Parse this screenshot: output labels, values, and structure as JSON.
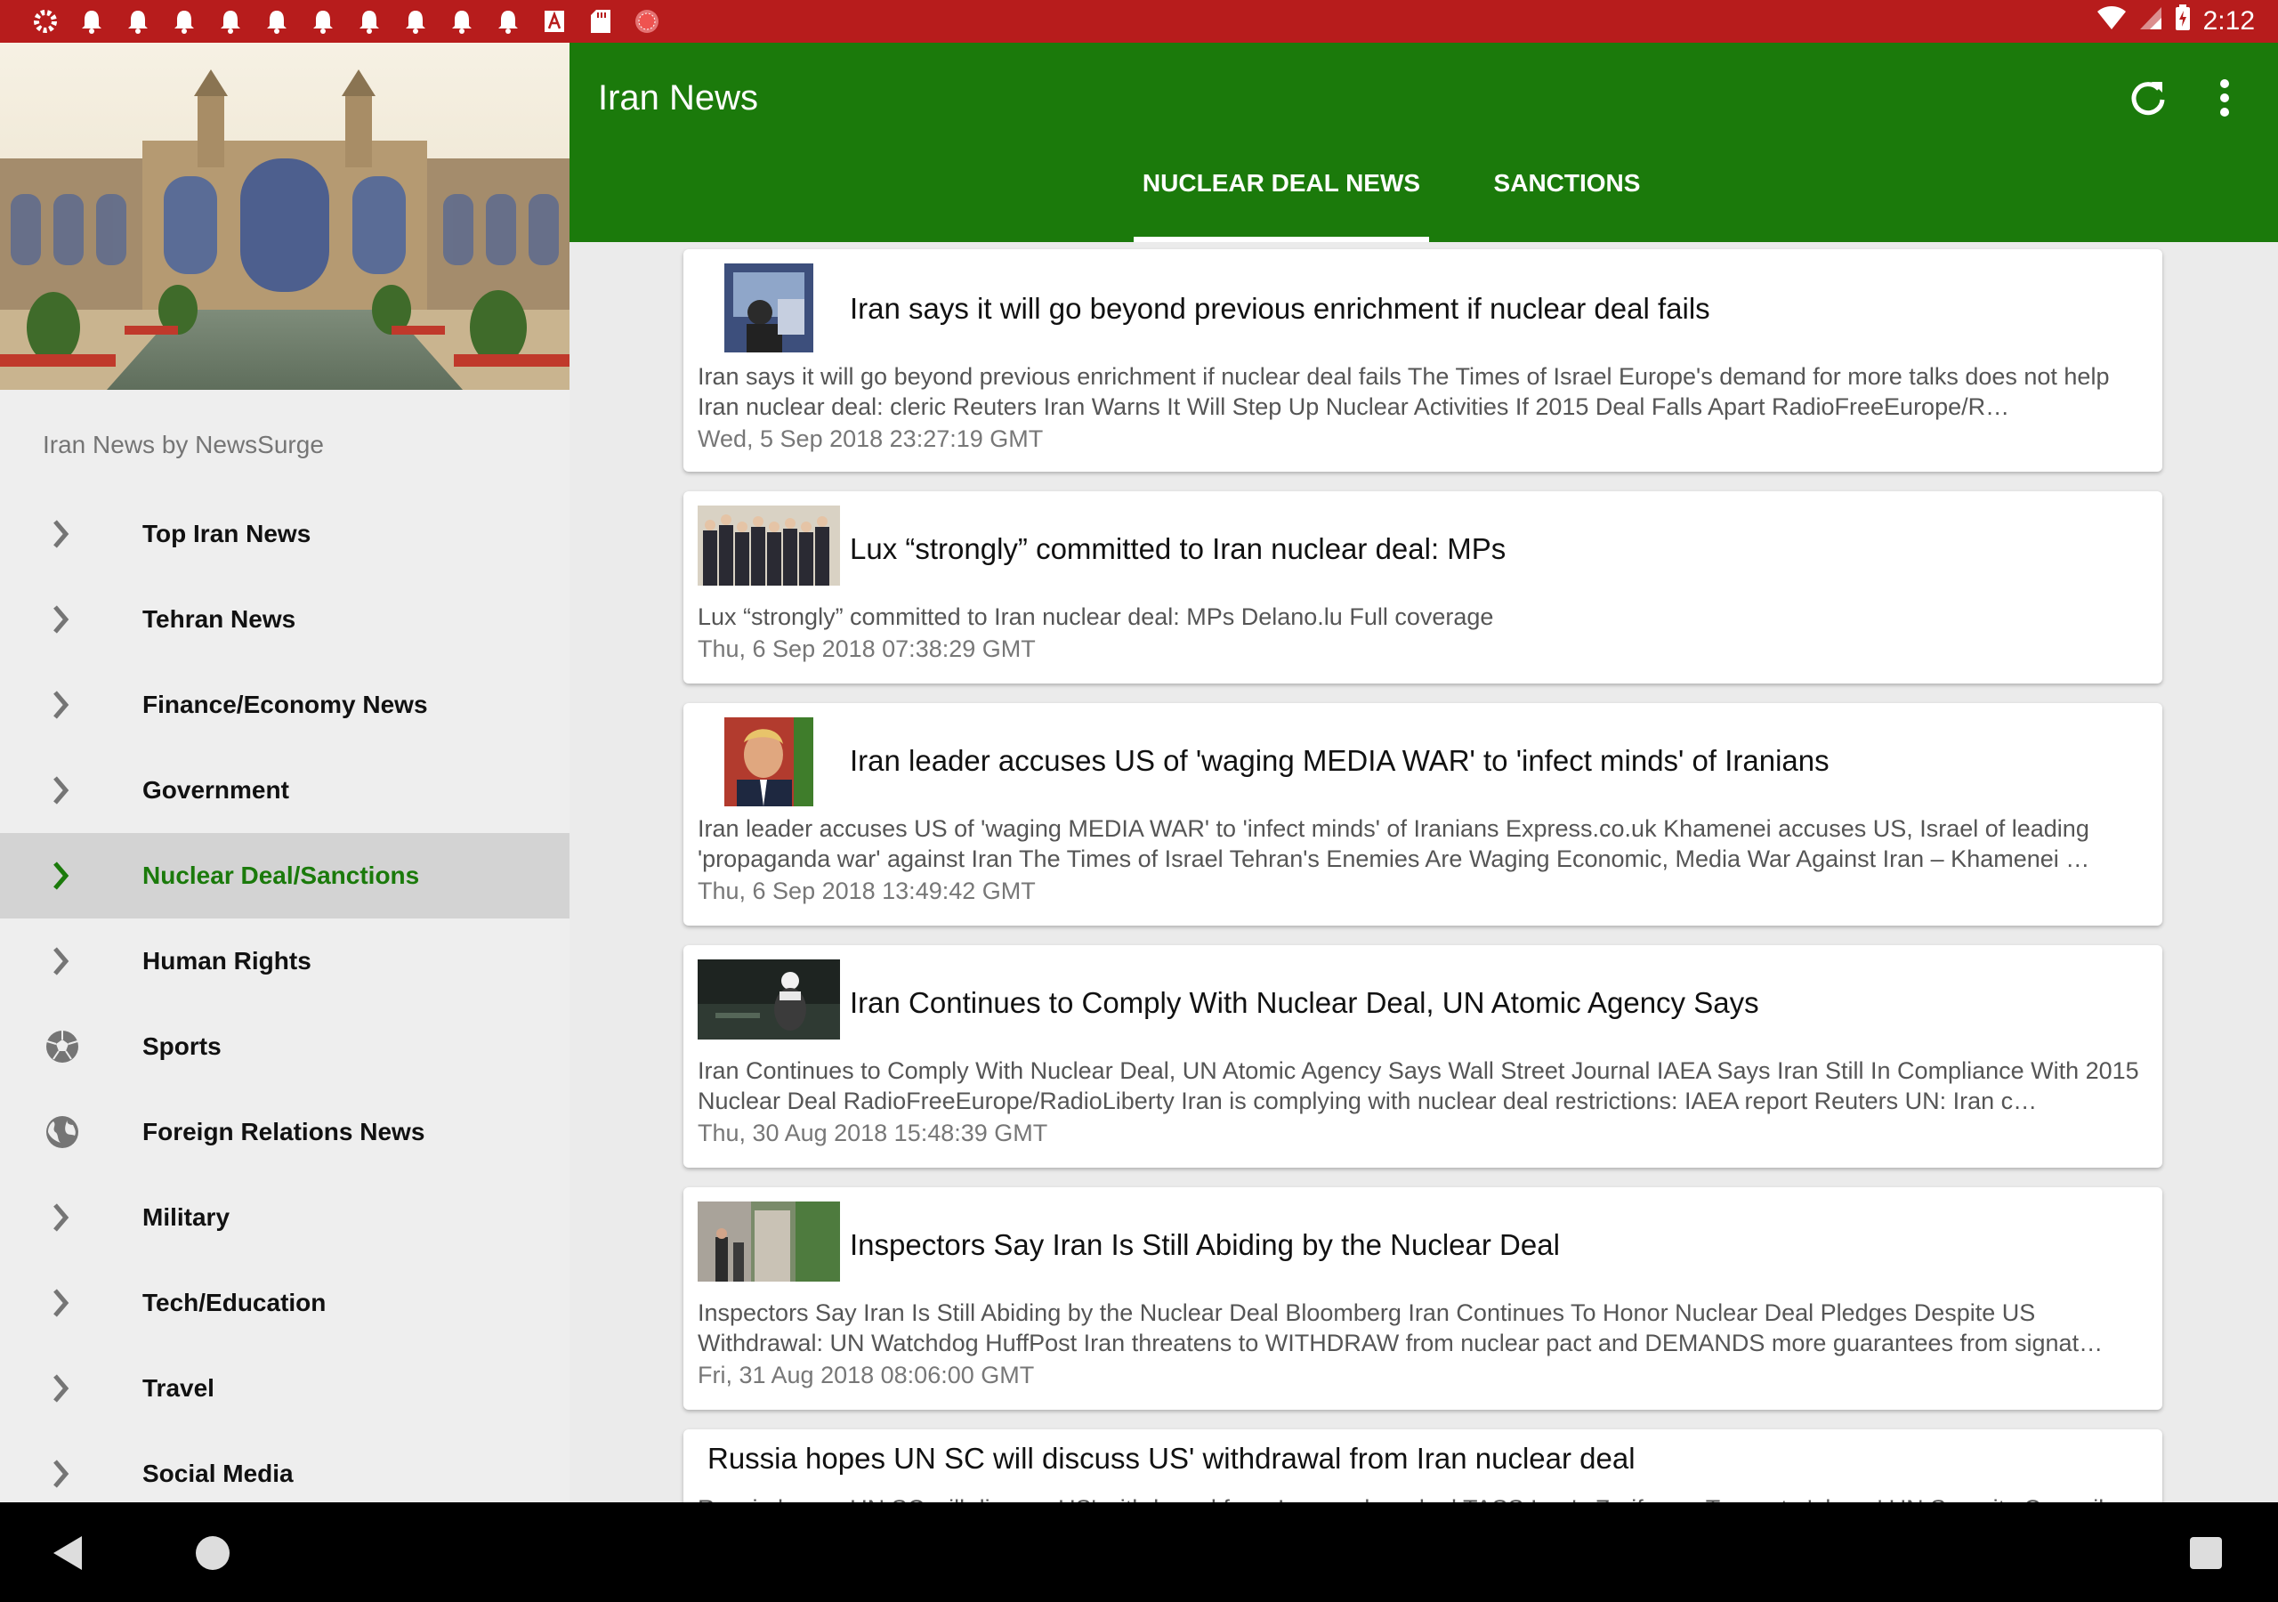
{
  "status_bar": {
    "time": "2:12",
    "notification_icons": [
      "gear-icon",
      "bell-icon",
      "bell-icon",
      "bell-icon",
      "bell-icon",
      "bell-icon",
      "bell-icon",
      "bell-icon",
      "bell-icon",
      "bell-icon",
      "bell-icon",
      "font-icon",
      "sd-card-icon",
      "record-icon"
    ]
  },
  "drawer": {
    "subtitle": "Iran News by NewsSurge",
    "items": [
      {
        "label": "Top Iran News",
        "icon": "chevron-right-icon"
      },
      {
        "label": "Tehran News",
        "icon": "chevron-right-icon"
      },
      {
        "label": "Finance/Economy News",
        "icon": "chevron-right-icon"
      },
      {
        "label": "Government",
        "icon": "chevron-right-icon"
      },
      {
        "label": "Nuclear Deal/Sanctions",
        "icon": "chevron-right-icon",
        "active": true
      },
      {
        "label": "Human Rights",
        "icon": "chevron-right-icon"
      },
      {
        "label": "Sports",
        "icon": "soccer-ball-icon"
      },
      {
        "label": "Foreign Relations News",
        "icon": "globe-icon"
      },
      {
        "label": "Military",
        "icon": "chevron-right-icon"
      },
      {
        "label": "Tech/Education",
        "icon": "chevron-right-icon"
      },
      {
        "label": "Travel",
        "icon": "chevron-right-icon"
      },
      {
        "label": "Social Media",
        "icon": "chevron-right-icon"
      }
    ]
  },
  "app_bar": {
    "title": "Iran News",
    "tabs": [
      {
        "label": "NUCLEAR DEAL NEWS",
        "selected": true
      },
      {
        "label": "SANCTIONS",
        "selected": false
      }
    ]
  },
  "articles": [
    {
      "title": "Iran says it will go beyond previous enrichment if nuclear deal fails",
      "snippet": "Iran says it will go beyond previous enrichment if nuclear deal fails  The Times of Israel  Europe's demand for more talks does not help Iran nuclear deal: cleric  Reuters  Iran Warns It Will Step Up Nuclear Activities If 2015 Deal Falls Apart  RadioFreeEurope/R…",
      "date": "Wed, 5 Sep 2018 23:27:19 GMT"
    },
    {
      "title": "Lux “strongly” committed to Iran nuclear deal: MPs",
      "snippet": "Lux “strongly” committed to Iran nuclear deal: MPs  Delano.lu  Full coverage",
      "date": "Thu, 6 Sep 2018 07:38:29 GMT"
    },
    {
      "title": "Iran leader accuses US of 'waging MEDIA WAR' to 'infect minds' of Iranians",
      "snippet": "Iran leader accuses US of 'waging MEDIA WAR' to 'infect minds' of Iranians  Express.co.uk  Khamenei accuses US, Israel of leading 'propaganda war' against Iran  The Times of Israel  Tehran's Enemies Are Waging Economic, Media War Against Iran – Khamenei  …",
      "date": "Thu, 6 Sep 2018 13:49:42 GMT"
    },
    {
      "title": "Iran Continues to Comply With Nuclear Deal, UN Atomic Agency Says",
      "snippet": "Iran Continues to Comply With Nuclear Deal, UN Atomic Agency Says  Wall Street Journal  IAEA Says Iran Still In Compliance With 2015 Nuclear Deal  RadioFreeEurope/RadioLiberty  Iran is complying with nuclear deal restrictions: IAEA report  Reuters  UN: Iran c…",
      "date": "Thu, 30 Aug 2018 15:48:39 GMT"
    },
    {
      "title": "Inspectors Say Iran Is Still Abiding by the Nuclear Deal",
      "snippet": "Inspectors Say Iran Is Still Abiding by the Nuclear Deal  Bloomberg  Iran Continues To Honor Nuclear Deal Pledges Despite US Withdrawal: UN Watchdog  HuffPost  Iran threatens to WITHDRAW from nuclear pact and DEMANDS more guarantees from signat…",
      "date": "Fri, 31 Aug 2018 08:06:00 GMT"
    },
    {
      "title": "Russia hopes UN SC will discuss US' withdrawal from Iran nuclear deal",
      "snippet": "Russia hopes UN SC will discuss US' withdrawal from Iran nuclear deal  TASS  Iran's Zarif says Trump to 'abuse' UN Security Council",
      "date": ""
    }
  ]
}
